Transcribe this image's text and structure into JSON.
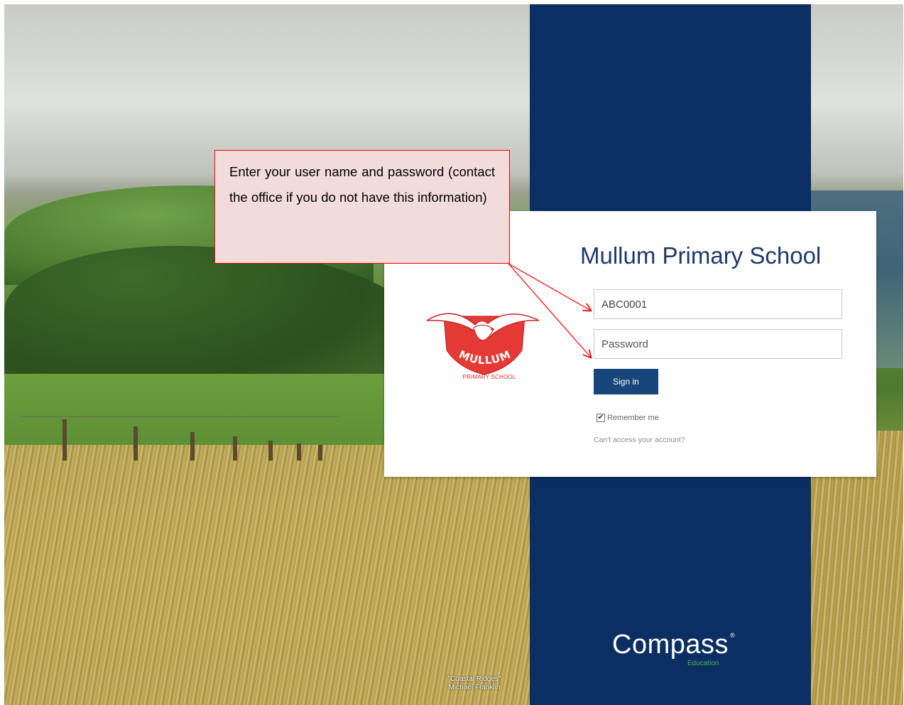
{
  "background": {
    "photo_credit_line1": "\"Coastal Ridges\"",
    "photo_credit_line2": "Michael Franklin"
  },
  "brand": {
    "name": "Compass",
    "sub": "Education",
    "reg_mark": "®",
    "panel_color": "#0c2f63"
  },
  "login": {
    "school_name": "Mullum Primary School",
    "logo_text": "MULLUM",
    "logo_sub": "PRIMARY SCHOOL",
    "username_value": "ABC0001",
    "password_placeholder": "Password",
    "signin_label": "Sign in",
    "remember_label": "Remember me",
    "remember_checked": true,
    "cant_access_label": "Can't access your account?",
    "signin_color": "#17467a"
  },
  "callout": {
    "text": "Enter your user name and password (contact the office if you do not have this information)",
    "border_color": "#ff0000",
    "fill_color": "#f2dcdb"
  }
}
